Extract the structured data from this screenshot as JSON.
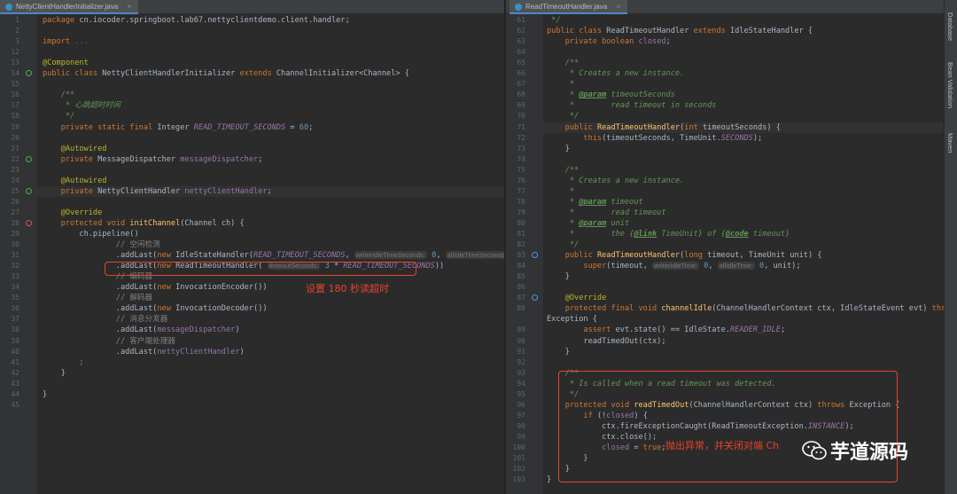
{
  "left": {
    "tab": "NettyClientHandlerInitializer.java",
    "lines": [
      {
        "n": "1",
        "html": "<span class='kw'>package</span> cn.iocoder.springboot.lab67.nettyclientdemo.client.handler;"
      },
      {
        "n": "2",
        "html": ""
      },
      {
        "n": "3",
        "html": "<span class='kw'>import</span> <span class='fold'>...</span>"
      },
      {
        "n": "12",
        "html": ""
      },
      {
        "n": "13",
        "html": "<span class='ann'>@Component</span>"
      },
      {
        "n": "14",
        "html": "<span class='kw'>public class</span> NettyClientHandlerInitializer <span class='kw'>extends</span> ChannelInitializer&lt;Channel&gt; {"
      },
      {
        "n": "15",
        "html": ""
      },
      {
        "n": "16",
        "html": "    <span class='doc'>/**</span>"
      },
      {
        "n": "17",
        "html": "    <span class='doc'> * 心跳超时时间</span>"
      },
      {
        "n": "18",
        "html": "    <span class='doc'> */</span>"
      },
      {
        "n": "19",
        "html": "    <span class='kw'>private static final</span> Integer <span class='cst'>READ_TIMEOUT_SECONDS</span> = <span class='num'>60</span>;"
      },
      {
        "n": "20",
        "html": ""
      },
      {
        "n": "21",
        "html": "    <span class='ann'>@Autowired</span>"
      },
      {
        "n": "22",
        "html": "    <span class='kw'>private</span> MessageDispatcher <span class='fld'>messageDispatcher</span>;"
      },
      {
        "n": "23",
        "html": ""
      },
      {
        "n": "24",
        "html": "    <span class='ann'>@Autowired</span>"
      },
      {
        "n": "25",
        "html": "    <span class='kw'>private</span> NettyClientHandler <span class='fld'>nettyClientHandler</span>;"
      },
      {
        "n": "26",
        "html": ""
      },
      {
        "n": "27",
        "html": "    <span class='ann'>@Override</span>"
      },
      {
        "n": "28",
        "html": "    <span class='kw'>protected void</span> <span class='fn'>initChannel</span>(Channel ch) {"
      },
      {
        "n": "29",
        "html": "        ch.pipeline()"
      },
      {
        "n": "30",
        "html": "                <span class='cm'>// 空闲检测</span>"
      },
      {
        "n": "31",
        "html": "                .addLast(<span class='kw'>new</span> IdleStateHandler(<span class='cst'>READ_TIMEOUT_SECONDS</span>, <span class='hint'>writerIdleTimeSeconds:</span> <span class='num'>0</span>, <span class='hint'>allIdleTimeSeconds:</span> <span class='num'>0</span>))"
      },
      {
        "n": "32",
        "html": "                .addLast(<span class='kw'>new</span> ReadTimeoutHandler( <span class='hint'>timeoutSeconds:</span> <span class='num'>3</span> * <span class='cst'>READ_TIMEOUT_SECONDS</span>))"
      },
      {
        "n": "33",
        "html": "                <span class='cm'>// 编码器</span>"
      },
      {
        "n": "34",
        "html": "                .addLast(<span class='kw'>new</span> InvocationEncoder())"
      },
      {
        "n": "35",
        "html": "                <span class='cm'>// 解码器</span>"
      },
      {
        "n": "36",
        "html": "                .addLast(<span class='kw'>new</span> InvocationDecoder())"
      },
      {
        "n": "37",
        "html": "                <span class='cm'>// 消息分发器</span>"
      },
      {
        "n": "38",
        "html": "                .addLast(<span class='fld'>messageDispatcher</span>)"
      },
      {
        "n": "39",
        "html": "                <span class='cm'>// 客户端处理器</span>"
      },
      {
        "n": "40",
        "html": "                .addLast(<span class='fld'>nettyClientHandler</span>)"
      },
      {
        "n": "41",
        "html": "        <span class='kw'>;</span>"
      },
      {
        "n": "42",
        "html": "    }"
      },
      {
        "n": "43",
        "html": ""
      },
      {
        "n": "44",
        "html": "}"
      },
      {
        "n": "45",
        "html": ""
      }
    ],
    "annotation": "设置 180 秒读超时"
  },
  "right": {
    "tab": "ReadTimeoutHandler.java",
    "lines": [
      {
        "n": "61",
        "html": "<span class='doc'> */</span>"
      },
      {
        "n": "62",
        "html": "<span class='kw'>public class</span> ReadTimeoutHandler <span class='kw'>extends</span> IdleStateHandler {"
      },
      {
        "n": "63",
        "html": "    <span class='kw'>private boolean</span> <span class='fld'>closed</span>;"
      },
      {
        "n": "64",
        "html": ""
      },
      {
        "n": "65",
        "html": "    <span class='doc'>/**</span>"
      },
      {
        "n": "66",
        "html": "    <span class='doc'> * Creates a new instance.</span>"
      },
      {
        "n": "67",
        "html": "    <span class='doc'> *</span>"
      },
      {
        "n": "68",
        "html": "    <span class='doc'> * <span class='doctag'>@param</span> timeoutSeconds</span>"
      },
      {
        "n": "69",
        "html": "    <span class='doc'> *        read timeout in seconds</span>"
      },
      {
        "n": "70",
        "html": "    <span class='doc'> */</span>"
      },
      {
        "n": "71",
        "html": "    <span class='kw'>public</span> <span class='fn'>ReadTimeoutHandler</span>(<span class='kw'>int</span> timeoutSeconds) {"
      },
      {
        "n": "72",
        "html": "        <span class='kw'>this</span>(timeoutSeconds, TimeUnit.<span class='cst'>SECONDS</span>);"
      },
      {
        "n": "73",
        "html": "    }"
      },
      {
        "n": "74",
        "html": ""
      },
      {
        "n": "75",
        "html": "    <span class='doc'>/**</span>"
      },
      {
        "n": "76",
        "html": "    <span class='doc'> * Creates a new instance.</span>"
      },
      {
        "n": "77",
        "html": "    <span class='doc'> *</span>"
      },
      {
        "n": "78",
        "html": "    <span class='doc'> * <span class='doctag'>@param</span> timeout</span>"
      },
      {
        "n": "79",
        "html": "    <span class='doc'> *        read timeout</span>"
      },
      {
        "n": "80",
        "html": "    <span class='doc'> * <span class='doctag'>@param</span> unit</span>"
      },
      {
        "n": "81",
        "html": "    <span class='doc'> *        the {<span class='doctag'>@link</span> TimeUnit} of {<span class='doctag'>@code</span> timeout}</span>"
      },
      {
        "n": "82",
        "html": "    <span class='doc'> */</span>"
      },
      {
        "n": "83",
        "html": "    <span class='kw'>public</span> <span class='fn'>ReadTimeoutHandler</span>(<span class='kw'>long</span> timeout, TimeUnit unit) {"
      },
      {
        "n": "84",
        "html": "        <span class='kw'>super</span>(timeout, <span class='hint'>writerIdleTime:</span> <span class='num'>0</span>, <span class='hint'>allIdleTime:</span> <span class='num'>0</span>, unit);"
      },
      {
        "n": "85",
        "html": "    }"
      },
      {
        "n": "86",
        "html": ""
      },
      {
        "n": "87",
        "html": "    <span class='ann'>@Override</span>"
      },
      {
        "n": "88",
        "html": "    <span class='kw'>protected final void</span> <span class='fn'>channelIdle</span>(ChannelHandlerContext ctx, IdleStateEvent evt) <span class='kw'>throws</span>"
      },
      {
        "n": "",
        "html": "Exception {"
      },
      {
        "n": "89",
        "html": "        <span class='kw'>assert</span> evt.state() == IdleState.<span class='cst'>READER_IDLE</span>;"
      },
      {
        "n": "90",
        "html": "        readTimedOut(ctx);"
      },
      {
        "n": "91",
        "html": "    }"
      },
      {
        "n": "92",
        "html": ""
      },
      {
        "n": "93",
        "html": "    <span class='doc'>/**</span>"
      },
      {
        "n": "94",
        "html": "    <span class='doc'> * Is called when a read timeout was detected.</span>"
      },
      {
        "n": "95",
        "html": "    <span class='doc'> */</span>"
      },
      {
        "n": "96",
        "html": "    <span class='kw'>protected void</span> <span class='fn'>readTimedOut</span>(ChannelHandlerContext ctx) <span class='kw'>throws</span> Exception {"
      },
      {
        "n": "97",
        "html": "        <span class='kw'>if</span> (!<span class='fld'>closed</span>) {"
      },
      {
        "n": "98",
        "html": "            ctx.fireExceptionCaught(ReadTimeoutException.<span class='cst'>INSTANCE</span>);"
      },
      {
        "n": "99",
        "html": "            ctx.close();"
      },
      {
        "n": "100",
        "html": "            <span class='fld'>closed</span> = <span class='kw'>true</span>;"
      },
      {
        "n": "101",
        "html": "        }"
      },
      {
        "n": "102",
        "html": "    }"
      },
      {
        "n": "103",
        "html": "}"
      }
    ],
    "annotation": "抛出异常，并关闭对端 Ch"
  },
  "side_toolbar": {
    "tabs": [
      "Database",
      "Bean Validation",
      "Maven"
    ]
  },
  "watermark": {
    "text": "芋道源码"
  },
  "colors": {
    "background": "#2b2b2b",
    "keyword": "#cc7832",
    "annotation_box": "#e8432c"
  }
}
